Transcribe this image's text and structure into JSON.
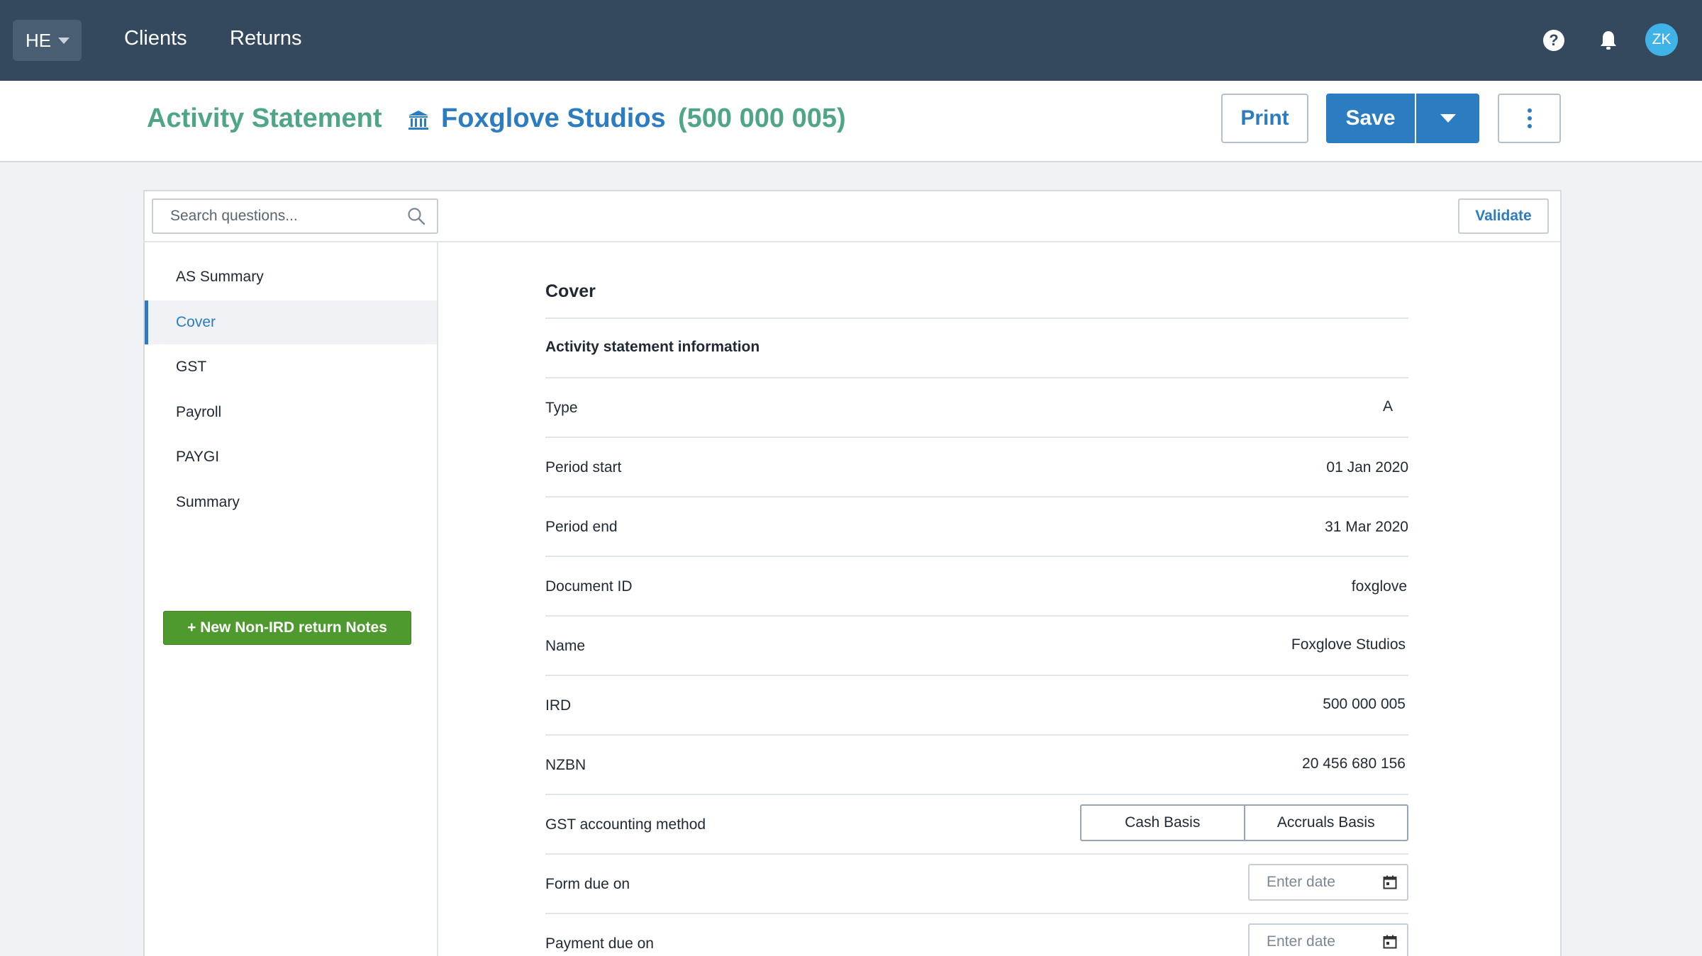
{
  "topnav": {
    "org_code": "HE",
    "links": {
      "clients": "Clients",
      "returns": "Returns"
    },
    "help_glyph": "?",
    "avatar_initials": "ZK"
  },
  "header": {
    "title": "Activity Statement",
    "client_icon": "bank-icon",
    "client_name": "Foxglove Studios",
    "client_ird": "(500 000 005)",
    "print_label": "Print",
    "save_label": "Save"
  },
  "toolbar": {
    "search_placeholder": "Search questions...",
    "validate_label": "Validate"
  },
  "sidebar": {
    "items": [
      {
        "label": "AS Summary"
      },
      {
        "label": "Cover",
        "active": true
      },
      {
        "label": "GST"
      },
      {
        "label": "Payroll"
      },
      {
        "label": "PAYGI"
      },
      {
        "label": "Summary"
      }
    ],
    "new_notes_label": "+ New Non-IRD return Notes"
  },
  "form": {
    "title": "Cover",
    "subheading": "Activity statement information",
    "fields": {
      "type": {
        "label": "Type",
        "value": "A"
      },
      "period_start": {
        "label": "Period start",
        "value": "01 Jan 2020"
      },
      "period_end": {
        "label": "Period end",
        "value": "31 Mar 2020"
      },
      "document_id": {
        "label": "Document ID",
        "value": "foxglove"
      },
      "name": {
        "label": "Name",
        "value": "Foxglove Studios"
      },
      "ird": {
        "label": "IRD",
        "value": "500 000 005"
      },
      "nzbn": {
        "label": "NZBN",
        "value": "20 456 680 156"
      },
      "gst_method": {
        "label": "GST accounting method",
        "options": [
          "Cash Basis",
          "Accruals Basis"
        ]
      },
      "form_due": {
        "label": "Form due on",
        "placeholder": "Enter date"
      },
      "payment_due": {
        "label": "Payment due on",
        "placeholder": "Enter date"
      }
    }
  },
  "colors": {
    "nav_bg": "#34495e",
    "title_green": "#4fa587",
    "accent_blue": "#2b7cc0",
    "notes_green": "#4e9a2e"
  }
}
